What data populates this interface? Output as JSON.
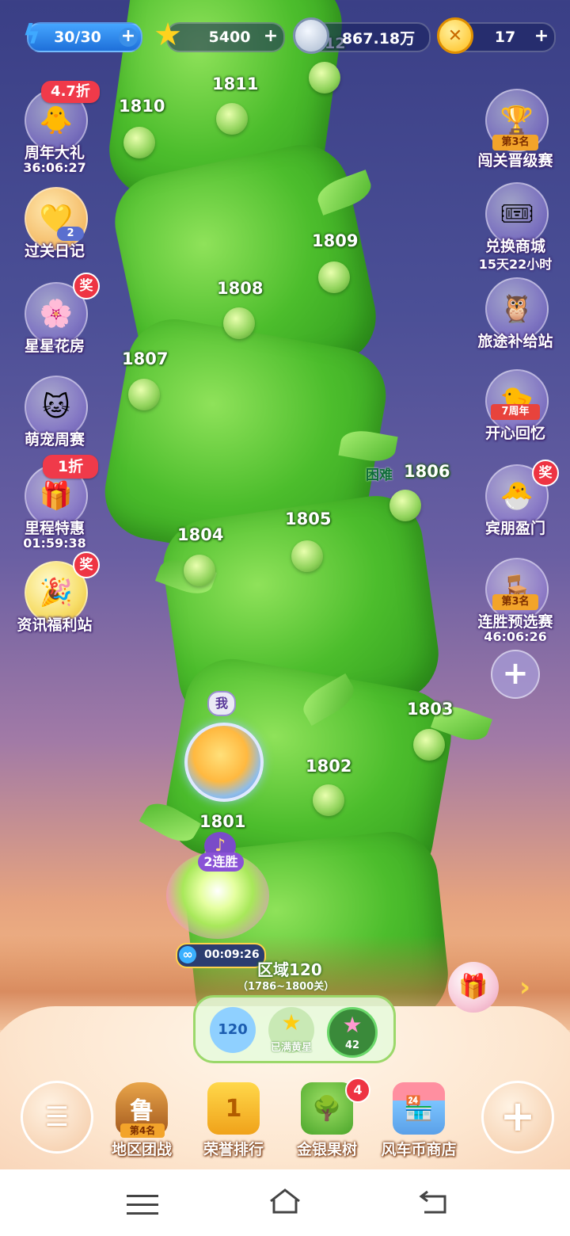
{
  "top_bar": {
    "energy": "30/30",
    "stars": "5400",
    "silver": "867.18万",
    "coins": "17",
    "plus": "+"
  },
  "levels": [
    "1801",
    "1802",
    "1803",
    "1804",
    "1805",
    "1806",
    "1807",
    "1808",
    "1809",
    "1810",
    "1811",
    "12"
  ],
  "hard_label": "困难",
  "left_menu": [
    {
      "label": "周年大礼",
      "sub": "36:06:27",
      "tag": "4.7折"
    },
    {
      "label": "过关日记",
      "badge": "2"
    },
    {
      "label": "星星花房",
      "tag": "奖"
    },
    {
      "label": "萌宠周赛"
    },
    {
      "label": "里程特惠",
      "sub": "01:59:38",
      "tag": "1折"
    },
    {
      "label": "资讯福利站",
      "tag": "奖"
    }
  ],
  "right_menu": [
    {
      "label": "闯关晋级赛",
      "rank": "第3名"
    },
    {
      "label": "兑换商城",
      "sub": "15天22小时"
    },
    {
      "label": "旅途补给站"
    },
    {
      "label": "开心回忆",
      "banner": "7周年"
    },
    {
      "label": "宾朋盈门",
      "tag": "奖"
    },
    {
      "label": "连胜预选赛",
      "sub": "46:06:26",
      "rank": "第3名"
    }
  ],
  "player": {
    "me_label": "我",
    "streak": "2连胜",
    "timer": "00:09:26"
  },
  "region": {
    "title": "区域120",
    "range": "（1786~1800关）",
    "stats": [
      "120",
      "已满黄星",
      "42"
    ]
  },
  "bottom_nav": [
    {
      "label": "地区团战",
      "rank": "第4名",
      "emblem": "鲁"
    },
    {
      "label": "荣誉排行",
      "emblem": "1"
    },
    {
      "label": "金银果树",
      "badge": "4"
    },
    {
      "label": "风车币商店"
    }
  ],
  "colors": {
    "accent": "#f03a4a",
    "vine": "#4cbd2c",
    "nav_bg": "#ffffff"
  }
}
